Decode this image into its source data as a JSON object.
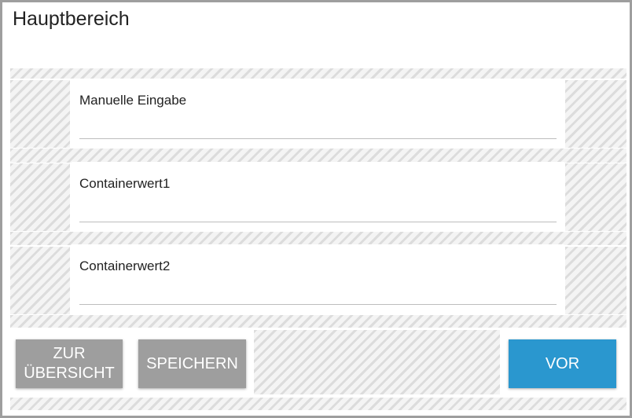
{
  "header": {
    "title": "Hauptbereich"
  },
  "fields": [
    {
      "label": "Manuelle Eingabe",
      "value": "",
      "placeholder": ""
    },
    {
      "label": "Containerwert1",
      "value": "",
      "placeholder": ""
    },
    {
      "label": "Containerwert2",
      "value": "",
      "placeholder": ""
    }
  ],
  "actions": {
    "overview_label": "ZUR ÜBERSICHT",
    "save_label": "SPEICHERN",
    "next_label": "VOR"
  },
  "colors": {
    "border": "#9e9e9e",
    "button_grey": "#9e9e9e",
    "button_blue": "#2a97cf",
    "hatch_stripe": "#dcdcdc",
    "hatch_background": "#f4f4f4"
  }
}
